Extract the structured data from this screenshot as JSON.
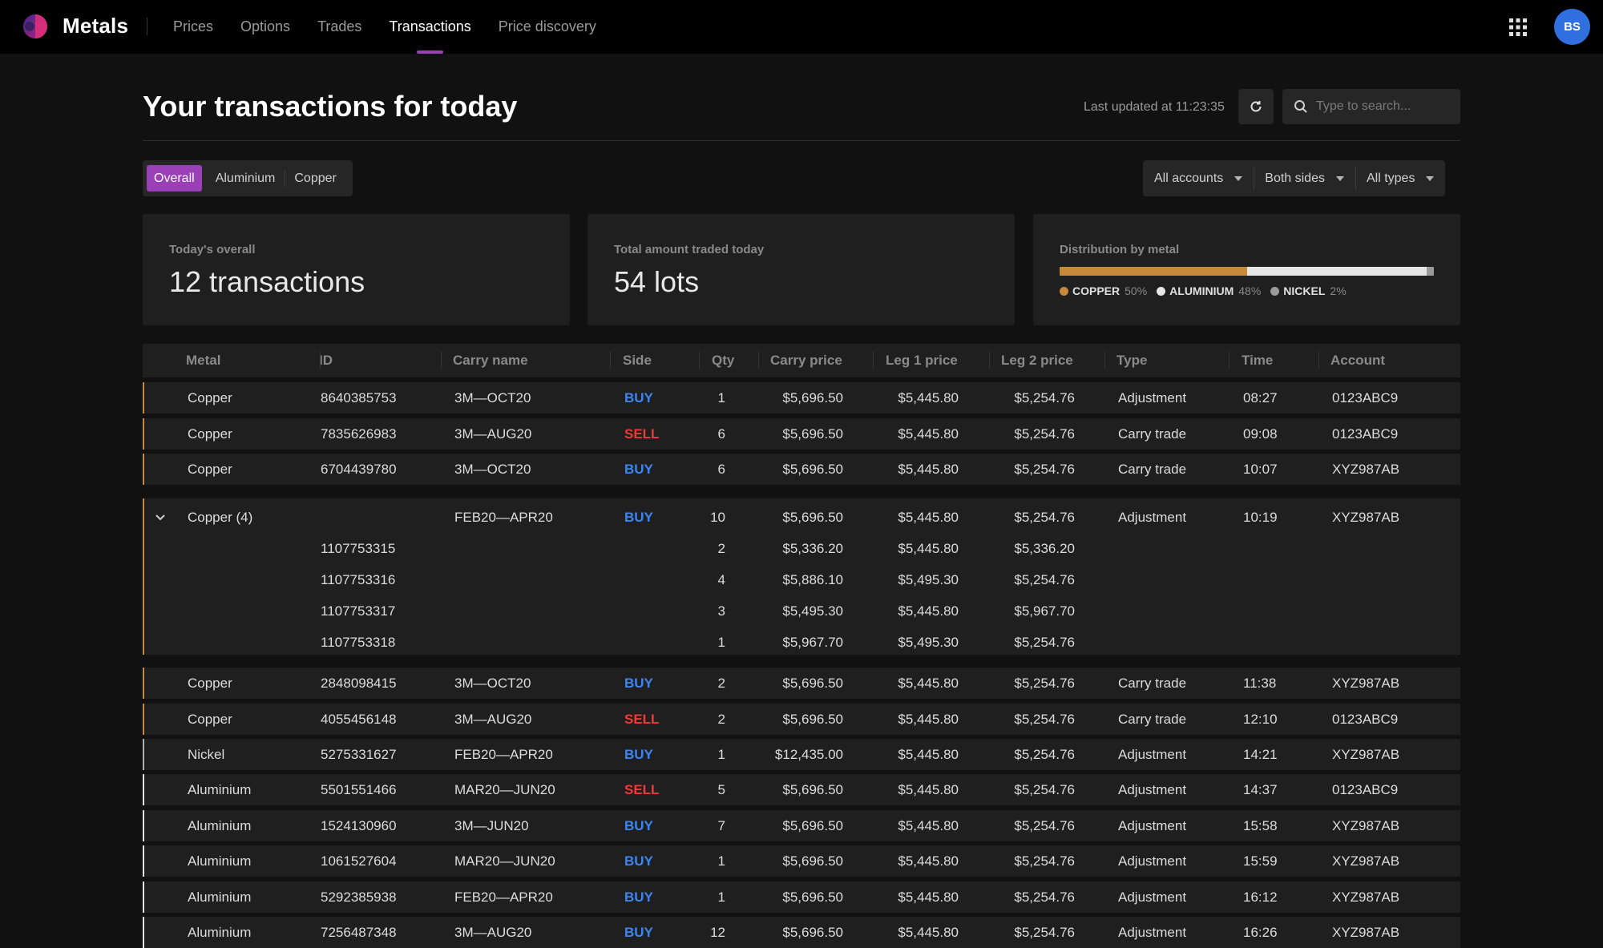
{
  "app": {
    "brand": "Metals",
    "nav": [
      "Prices",
      "Options",
      "Trades",
      "Transactions",
      "Price discovery"
    ],
    "active_nav": "Transactions",
    "user_initials": "BS",
    "accent": "#9b3fb6"
  },
  "header": {
    "title": "Your transactions for today",
    "last_updated": "Last updated at 11:23:35",
    "search_placeholder": "Type to search..."
  },
  "segments": [
    "Overall",
    "Aluminium",
    "Copper"
  ],
  "active_segment": "Overall",
  "filters": [
    "All accounts",
    "Both sides",
    "All types"
  ],
  "summary": {
    "overall": {
      "label": "Today's overall",
      "value": "12 transactions"
    },
    "total": {
      "label": "Total amount traded today",
      "value": "54 lots"
    },
    "distribution": {
      "label": "Distribution by metal",
      "items": [
        {
          "name": "COPPER",
          "pct": "50%",
          "fraction": 0.5,
          "color": "#c68a3a"
        },
        {
          "name": "ALUMINIUM",
          "pct": "48%",
          "fraction": 0.48,
          "color": "#e6e6e6"
        },
        {
          "name": "NICKEL",
          "pct": "2%",
          "fraction": 0.02,
          "color": "#9a9a9a"
        }
      ]
    }
  },
  "table": {
    "columns": [
      "Metal",
      "ID",
      "Carry name",
      "Side",
      "Qty",
      "Carry price",
      "Leg 1 price",
      "Leg 2 price",
      "Type",
      "Time",
      "Account"
    ],
    "rows_top": [
      {
        "metal": "Copper",
        "id": "8640385753",
        "carry": "3M—OCT20",
        "side": "BUY",
        "qty": "1",
        "carry_price": "$5,696.50",
        "leg1": "$5,445.80",
        "leg2": "$5,254.76",
        "type": "Adjustment",
        "time": "08:27",
        "account": "0123ABC9"
      },
      {
        "metal": "Copper",
        "id": "7835626983",
        "carry": "3M—AUG20",
        "side": "SELL",
        "qty": "6",
        "carry_price": "$5,696.50",
        "leg1": "$5,445.80",
        "leg2": "$5,254.76",
        "type": "Carry trade",
        "time": "09:08",
        "account": "0123ABC9"
      },
      {
        "metal": "Copper",
        "id": "6704439780",
        "carry": "3M—OCT20",
        "side": "BUY",
        "qty": "6",
        "carry_price": "$5,696.50",
        "leg1": "$5,445.80",
        "leg2": "$5,254.76",
        "type": "Carry trade",
        "time": "10:07",
        "account": "XYZ987AB"
      }
    ],
    "group": {
      "metal": "Copper (4)",
      "carry": "FEB20—APR20",
      "side": "BUY",
      "qty": "10",
      "carry_price": "$5,696.50",
      "leg1": "$5,445.80",
      "leg2": "$5,254.76",
      "type": "Adjustment",
      "time": "10:19",
      "account": "XYZ987AB",
      "children": [
        {
          "id": "1107753315",
          "qty": "2",
          "carry_price": "$5,336.20",
          "leg1": "$5,445.80",
          "leg2": "$5,336.20"
        },
        {
          "id": "1107753316",
          "qty": "4",
          "carry_price": "$5,886.10",
          "leg1": "$5,495.30",
          "leg2": "$5,254.76"
        },
        {
          "id": "1107753317",
          "qty": "3",
          "carry_price": "$5,495.30",
          "leg1": "$5,445.80",
          "leg2": "$5,967.70"
        },
        {
          "id": "1107753318",
          "qty": "1",
          "carry_price": "$5,967.70",
          "leg1": "$5,495.30",
          "leg2": "$5,254.76"
        }
      ]
    },
    "rows_bottom": [
      {
        "metal": "Copper",
        "id": "2848098415",
        "carry": "3M—OCT20",
        "side": "BUY",
        "qty": "2",
        "carry_price": "$5,696.50",
        "leg1": "$5,445.80",
        "leg2": "$5,254.76",
        "type": "Carry trade",
        "time": "11:38",
        "account": "XYZ987AB"
      },
      {
        "metal": "Copper",
        "id": "4055456148",
        "carry": "3M—AUG20",
        "side": "SELL",
        "qty": "2",
        "carry_price": "$5,696.50",
        "leg1": "$5,445.80",
        "leg2": "$5,254.76",
        "type": "Carry trade",
        "time": "12:10",
        "account": "0123ABC9"
      },
      {
        "metal": "Nickel",
        "id": "5275331627",
        "carry": "FEB20—APR20",
        "side": "BUY",
        "qty": "1",
        "carry_price": "$12,435.00",
        "leg1": "$5,445.80",
        "leg2": "$5,254.76",
        "type": "Adjustment",
        "time": "14:21",
        "account": "XYZ987AB"
      },
      {
        "metal": "Aluminium",
        "id": "5501551466",
        "carry": "MAR20—JUN20",
        "side": "SELL",
        "qty": "5",
        "carry_price": "$5,696.50",
        "leg1": "$5,445.80",
        "leg2": "$5,254.76",
        "type": "Adjustment",
        "time": "14:37",
        "account": "0123ABC9"
      },
      {
        "metal": "Aluminium",
        "id": "1524130960",
        "carry": "3M—JUN20",
        "side": "BUY",
        "qty": "7",
        "carry_price": "$5,696.50",
        "leg1": "$5,445.80",
        "leg2": "$5,254.76",
        "type": "Adjustment",
        "time": "15:58",
        "account": "XYZ987AB"
      },
      {
        "metal": "Aluminium",
        "id": "1061527604",
        "carry": "MAR20—JUN20",
        "side": "BUY",
        "qty": "1",
        "carry_price": "$5,696.50",
        "leg1": "$5,445.80",
        "leg2": "$5,254.76",
        "type": "Adjustment",
        "time": "15:59",
        "account": "XYZ987AB"
      },
      {
        "metal": "Aluminium",
        "id": "5292385938",
        "carry": "FEB20—APR20",
        "side": "BUY",
        "qty": "1",
        "carry_price": "$5,696.50",
        "leg1": "$5,445.80",
        "leg2": "$5,254.76",
        "type": "Adjustment",
        "time": "16:12",
        "account": "XYZ987AB"
      },
      {
        "metal": "Aluminium",
        "id": "7256487348",
        "carry": "3M—AUG20",
        "side": "BUY",
        "qty": "12",
        "carry_price": "$5,696.50",
        "leg1": "$5,445.80",
        "leg2": "$5,254.76",
        "type": "Adjustment",
        "time": "16:26",
        "account": "XYZ987AB"
      }
    ]
  }
}
